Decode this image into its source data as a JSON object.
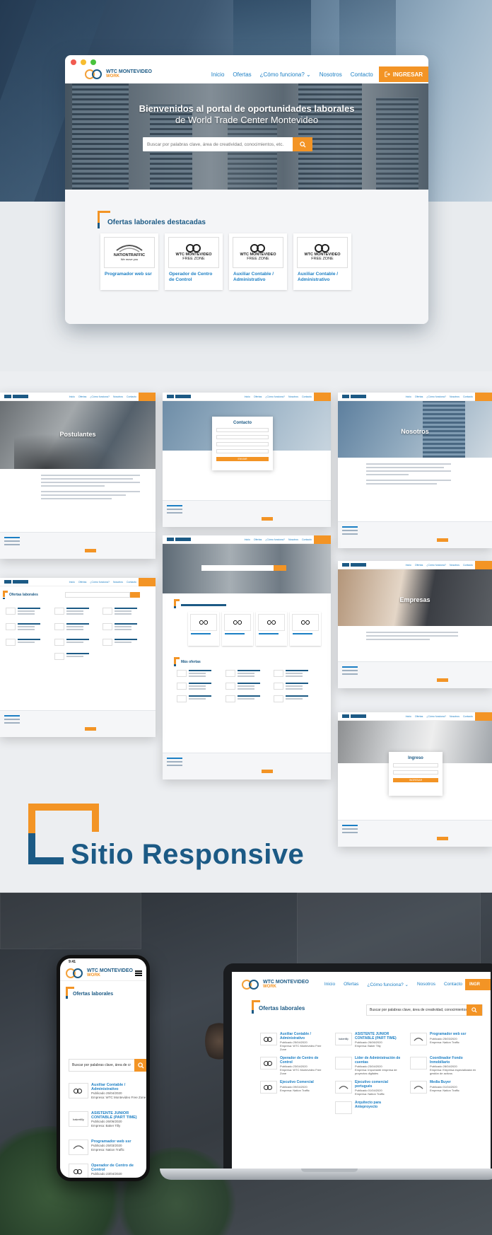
{
  "brand": {
    "name": "WTC MONTEVIDEO",
    "sub": "WORK",
    "orange": "#f39425",
    "blue": "#1c5a85",
    "link_blue": "#1c7fc4"
  },
  "nav": {
    "links": [
      "Inicio",
      "Ofertas",
      "¿Cómo funciona? ⌄",
      "Nosotros",
      "Contacto"
    ],
    "login": "INGRESAR"
  },
  "hero": {
    "line1": "Bienvenidos al portal de oportunidades laborales",
    "line2": "de World Trade Center Montevideo",
    "search_placeholder": "Buscar por palabras clave, área de creatividad, conocimientos, etc."
  },
  "featured": {
    "title": "Ofertas laborales destacadas",
    "cards": [
      {
        "company": "NATIONTRAFFIC",
        "tagline": "We move you",
        "title": "Programador web ssr"
      },
      {
        "company": "WTC MONTEVIDEO",
        "tagline": "FREE ZONE",
        "title": "Operador de Centro de Control"
      },
      {
        "company": "WTC MONTEVIDEO",
        "tagline": "FREE ZONE",
        "title": "Auxiliar Contable / Administrativo"
      },
      {
        "company": "WTC MONTEVIDEO",
        "tagline": "FREE ZONE",
        "title": "Auxiliar Contable / Administrativo"
      }
    ]
  },
  "screens": {
    "postulantes": "Postulantes",
    "contacto": "Contacto",
    "contacto_button": "ENVIAR",
    "nosotros": "Nosotros",
    "empresas": "Empresas",
    "ingreso": "Ingreso",
    "ingreso_button": "INGRESAR",
    "ofertas": "Ofertas laborales",
    "mas_ofertas": "Más ofertas"
  },
  "responsive": {
    "title": "Sitio Responsive"
  },
  "phone": {
    "time": "9:41",
    "section": "Ofertas laborales",
    "search_placeholder": "Buscar por palabras clave, área de cr",
    "items": [
      {
        "title": "Auxiliar Contable / Administrativo",
        "date": "Publicado 25/04/2020",
        "company": "Empresa: WTC Montevideo Free Zone"
      },
      {
        "title": "ASISTENTE JUNIOR CONTABLE (PART TIME)",
        "date": "Publicado 26/06/2020",
        "company": "Empresa: Baker Tilly"
      },
      {
        "title": "Programador web ssr",
        "date": "Publicado 25/03/2020",
        "company": "Empresa: Nation Traffic"
      },
      {
        "title": "Operador de Centro de Control",
        "date": "Publicado 23/04/2020",
        "company": ""
      }
    ]
  },
  "laptop": {
    "nav_links": [
      "Inicio",
      "Ofertas",
      "¿Cómo funciona? ⌄",
      "Nosotros",
      "Contacto"
    ],
    "login": "INGR",
    "section": "Ofertas laborales",
    "search_placeholder": "Buscar por palabras clave, área de creatividad, conocimientos, etc.",
    "items": [
      {
        "title": "Auxiliar Contable / Administrativo",
        "date": "Publicado 25/04/2020",
        "company": "Empresa: WTC Montevideo Free Zone"
      },
      {
        "title": "ASISTENTE JUNIOR CONTABLE (PART TIME)",
        "date": "Publicado 26/06/2020",
        "company": "Empresa: Baker Tilly"
      },
      {
        "title": "Programador web ssr",
        "date": "Publicado 25/03/2020",
        "company": "Empresa: Nation Traffic"
      },
      {
        "title": "Operador de Centro de Control",
        "date": "Publicado 23/04/2020",
        "company": "Empresa: WTC Montevideo Free Zone"
      },
      {
        "title": "Líder de Administración de cuentas",
        "date": "Publicado 23/04/2020",
        "company": "Empresa: Importante empresa de proyectos digitales"
      },
      {
        "title": "Coordinador Fondo Inmobiliario",
        "date": "Publicado 28/04/2020",
        "company": "Empresa: Empresa especializada en gestión de activos"
      },
      {
        "title": "Ejecutivo Comercial",
        "date": "Publicado 09/04/2020",
        "company": "Empresa: Nation Traffic"
      },
      {
        "title": "Ejecutivo comercial portugués",
        "date": "Publicado 01/04/2020",
        "company": "Empresa: Nation Traffic"
      },
      {
        "title": "Media Buyer",
        "date": "Publicado 01/04/2020",
        "company": "Empresa: Nation Traffic"
      },
      {
        "title": "Arquitecto para Anteproyecto",
        "date": "",
        "company": ""
      }
    ]
  }
}
